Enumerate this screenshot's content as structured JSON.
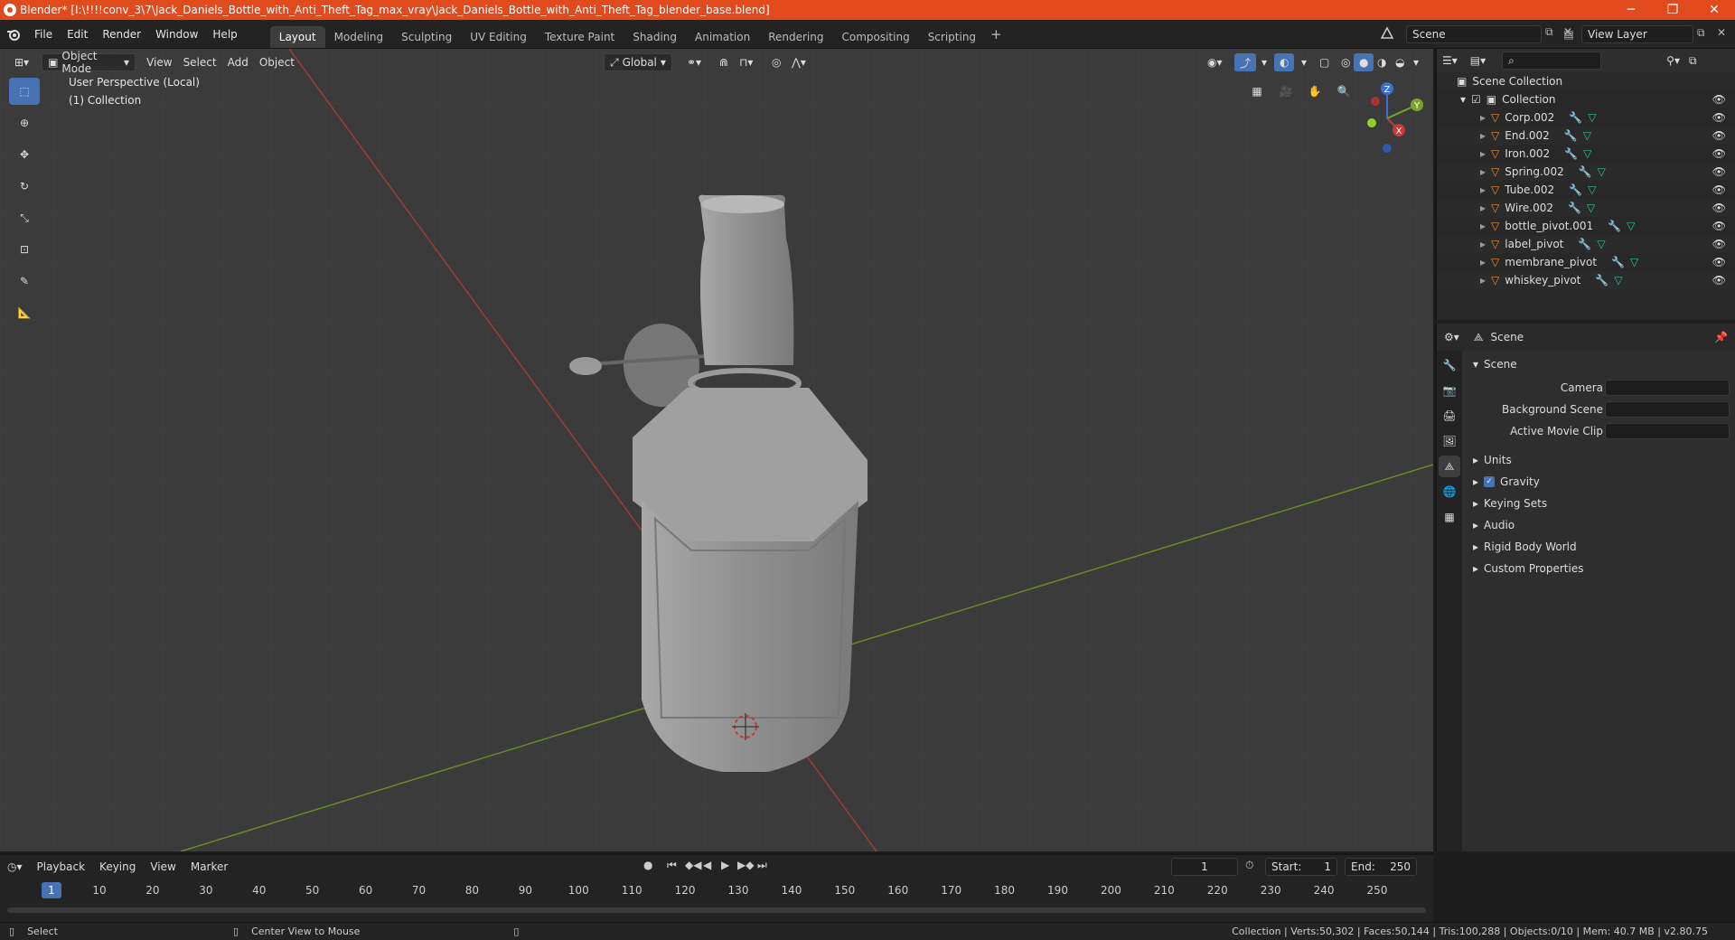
{
  "window": {
    "title": "Blender* [I:\\!!!!conv_3\\7\\Jack_Daniels_Bottle_with_Anti_Theft_Tag_max_vray\\Jack_Daniels_Bottle_with_Anti_Theft_Tag_blender_base.blend]",
    "minimize": "─",
    "maximize": "❐",
    "close": "✕",
    "accent": "#e04a1c"
  },
  "menubar": {
    "items": [
      "File",
      "Edit",
      "Render",
      "Window",
      "Help"
    ],
    "workspaces": [
      "Layout",
      "Modeling",
      "Sculpting",
      "UV Editing",
      "Texture Paint",
      "Shading",
      "Animation",
      "Rendering",
      "Compositing",
      "Scripting"
    ],
    "active_workspace": "Layout",
    "add": "+",
    "scene": "Scene",
    "view_layer": "View Layer"
  },
  "viewport": {
    "mode": "Object Mode",
    "menus": [
      "View",
      "Select",
      "Add",
      "Object"
    ],
    "orientation": "Global",
    "perspective_label": "User Perspective (Local)",
    "collection_label": "(1) Collection",
    "gizmo": {
      "z": "Z",
      "y": "Y",
      "x": "X"
    }
  },
  "outliner": {
    "root": "Scene Collection",
    "collection": "Collection",
    "items": [
      "Corp.002",
      "End.002",
      "Iron.002",
      "Spring.002",
      "Tube.002",
      "Wire.002",
      "bottle_pivot.001",
      "label_pivot",
      "membrane_pivot",
      "whiskey_pivot"
    ]
  },
  "properties": {
    "context": "Scene",
    "panel": "Scene",
    "fields": [
      {
        "label": "Camera"
      },
      {
        "label": "Background Scene"
      },
      {
        "label": "Active Movie Clip"
      }
    ],
    "subpanels": [
      "Units",
      "Gravity",
      "Keying Sets",
      "Audio",
      "Rigid Body World",
      "Custom Properties"
    ],
    "gravity_checked": true
  },
  "timeline": {
    "menus": [
      "Playback",
      "Keying",
      "View",
      "Marker"
    ],
    "current_frame": "1",
    "start_label": "Start:",
    "start": "1",
    "end_label": "End:",
    "end": "250",
    "ticks": [
      10,
      20,
      30,
      40,
      50,
      60,
      70,
      80,
      90,
      100,
      110,
      120,
      130,
      140,
      150,
      160,
      170,
      180,
      190,
      200,
      210,
      220,
      230,
      240,
      250
    ],
    "marker": "1"
  },
  "statusbar": {
    "left": "Select",
    "middle": "Center View to Mouse",
    "right": "Collection | Verts:50,302 | Faces:50,144 | Tris:100,288 | Objects:0/10 | Mem: 40.7 MB | v2.80.75"
  }
}
